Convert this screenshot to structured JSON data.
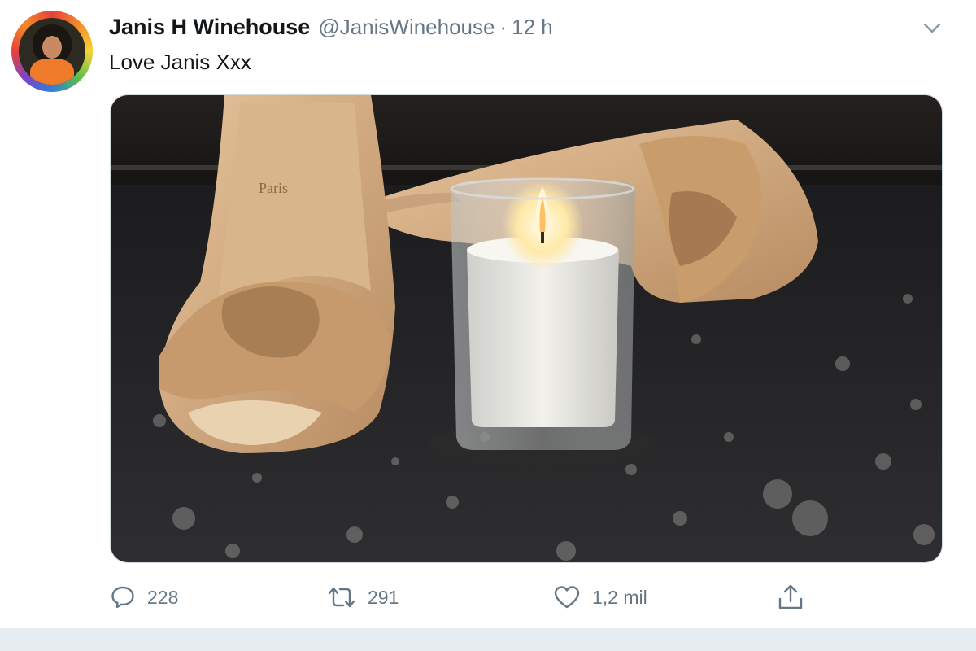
{
  "tweet": {
    "author_name": "Janis H Winehouse",
    "handle": "@JanisWinehouse",
    "separator": "·",
    "time": "12 h",
    "text": "Love Janis Xxx",
    "image_text": "Paris"
  },
  "actions": {
    "replies": "228",
    "retweets": "291",
    "likes": "1,2 mil"
  },
  "icons": {
    "reply": "reply-icon",
    "retweet": "retweet-icon",
    "like": "like-icon",
    "share": "share-icon",
    "more": "chevron-down-icon"
  },
  "colors": {
    "text": "#14171a",
    "secondary": "#657786",
    "background_strip": "#e6ecf0"
  }
}
